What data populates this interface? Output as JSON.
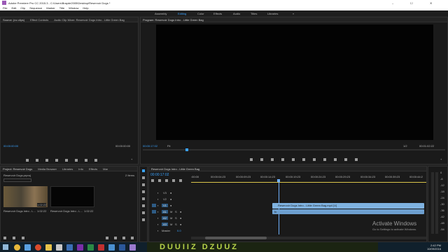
{
  "window": {
    "title": "Adobe Premiere Pro CC 2015.3 - C:\\Users\\Brayde2005\\Desktop\\Reservoir Dogs *",
    "controls": [
      "–",
      "☐",
      "✕"
    ]
  },
  "menu": [
    "File",
    "Edit",
    "Clip",
    "Sequence",
    "Marker",
    "Title",
    "Window",
    "Help"
  ],
  "workspaces": [
    "Assembly",
    "Editing",
    "Color",
    "Effects",
    "Audio",
    "Titles",
    "Libraries"
  ],
  "workspace_more": "»",
  "source_panel": {
    "tabs": [
      "Source: (no clips)",
      "Effect Controls",
      "Audio Clip Mixer: Reservoir Dogs Intro - Little Green Bag"
    ],
    "timecode_left": "00:00:00:00",
    "timecode_right": "00:00:00:00"
  },
  "program_panel": {
    "tab": "Program: Reservoir Dogs Intro - Little Green Bag",
    "timecode": "00:00:17:02",
    "fit": "Fit",
    "quality": "1/2",
    "duration": "00:01:02:22"
  },
  "project_panel": {
    "tabs": [
      "Project: Reservoir Dogs",
      "Media Browser",
      "Libraries",
      "Info",
      "Effects",
      "Mar"
    ],
    "path": "Reservoir Dogs.prproj",
    "count": "2 Items",
    "items": [
      {
        "name": "Reservoir Dogs Intro - L...",
        "duration": "1:02:22",
        "badge": "1:02:22"
      },
      {
        "name": "Reservoir Dogs Intro - L...",
        "duration": "1:02:22",
        "badge": ""
      }
    ]
  },
  "timeline": {
    "tab": "Reservoir Dogs Intro - Little Green Bag",
    "timecode": "00:00:17:02",
    "ruler": [
      ":00:00",
      "00:00:04:23",
      "00:00:09:23",
      "00:00:14:23",
      "00:00:19:23",
      "00:00:24:23",
      "00:00:29:23",
      "00:00:34:23",
      "00:00:39:23",
      "00:00:44:2"
    ],
    "tracks": [
      {
        "id": "V3",
        "type": "video"
      },
      {
        "id": "V2",
        "type": "video"
      },
      {
        "id": "V1",
        "type": "video"
      },
      {
        "id": "A1",
        "type": "audio"
      },
      {
        "id": "A2",
        "type": "audio"
      },
      {
        "id": "A3",
        "type": "audio"
      }
    ],
    "master": "Master",
    "master_value": "0.0",
    "clip_label": "Reservoir Dogs Intro - Little Green Bag.mp4 [V]"
  },
  "meters": [
    "0",
    "-6",
    "-12",
    "-18",
    "-24",
    "-30",
    "-36",
    "-42",
    "-48",
    "-54"
  ],
  "watermark": {
    "line1": "Activate Windows",
    "line2": "Go to Settings to activate Windows."
  },
  "taskbar": {
    "time": "2:42 PM",
    "date": "10/09/2016",
    "banner": "DUUIIZ DZUUZ"
  },
  "colors": {
    "accent": "#3aa3ff",
    "clip": "#7fb2e0",
    "playhead": "#6fb1ff",
    "workarea": "#d8c34a"
  }
}
